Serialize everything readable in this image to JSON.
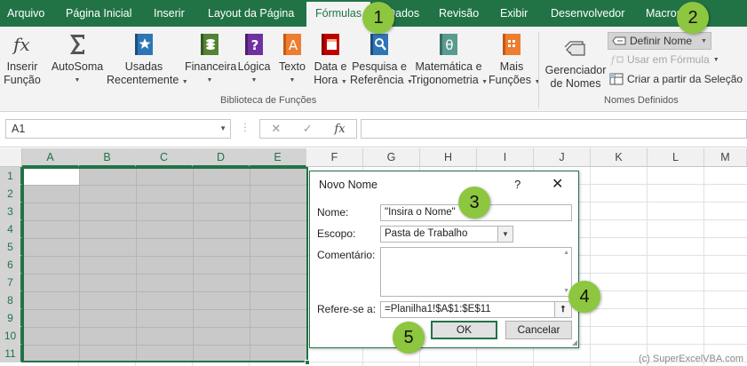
{
  "tabs": [
    "Arquivo",
    "Página Inicial",
    "Inserir",
    "Layout da Página",
    "Fórmulas",
    "Dados",
    "Revisão",
    "Exibir",
    "Desenvolvedor",
    "Macros"
  ],
  "active_tab": "Fórmulas",
  "ribbon": {
    "insert_function": [
      "Inserir",
      "Função"
    ],
    "autosum": "AutoSoma",
    "recent": [
      "Usadas",
      "Recentemente"
    ],
    "financial": "Financeira",
    "logical": "Lógica",
    "text": "Texto",
    "datetime": [
      "Data e",
      "Hora"
    ],
    "lookup": [
      "Pesquisa e",
      "Referência"
    ],
    "math": [
      "Matemática e",
      "Trigonometria"
    ],
    "more": [
      "Mais",
      "Funções"
    ],
    "library_label": "Biblioteca de Funções",
    "name_manager": [
      "Gerenciador",
      "de Nomes"
    ],
    "define_name": "Definir Nome",
    "use_in_formula": "Usar em Fórmula",
    "create_from_selection": "Criar a partir da Seleção",
    "names_label": "Nomes Definidos"
  },
  "formula_bar": {
    "name_box": "A1",
    "cancel_glyph": "✕",
    "enter_glyph": "✓",
    "fx_glyph": "fx"
  },
  "grid": {
    "columns": [
      "A",
      "B",
      "C",
      "D",
      "E",
      "F",
      "G",
      "H",
      "I",
      "J",
      "K",
      "L",
      "M"
    ],
    "rows": [
      "1",
      "2",
      "3",
      "4",
      "5",
      "6",
      "7",
      "8",
      "9",
      "10",
      "11"
    ]
  },
  "dialog": {
    "title": "Novo Nome",
    "help": "?",
    "close": "✕",
    "name_label": "Nome:",
    "name_value": "\"Insira o Nome\"",
    "scope_label": "Escopo:",
    "scope_value": "Pasta de Trabalho",
    "comment_label": "Comentário:",
    "refers_label": "Refere-se a:",
    "refers_value": "=Planilha1!$A$1:$E$11",
    "ok": "OK",
    "cancel": "Cancelar"
  },
  "badges": [
    "1",
    "2",
    "3",
    "4",
    "5"
  ],
  "watermark": "(c) SuperExcelVBA.com",
  "colors": {
    "excel_green": "#217346",
    "badge_green": "#8dc63f",
    "selection_gray": "#c9c9c9"
  },
  "icons": {
    "insert_function": "fx-icon",
    "autosum": "sigma-icon",
    "recent": "star-book-icon",
    "financial": "money-book-icon",
    "logical": "question-book-icon",
    "text": "text-book-icon",
    "datetime": "calendar-book-icon",
    "lookup": "magnifier-book-icon",
    "math": "theta-book-icon",
    "more": "grid-book-icon",
    "name_manager": "tag-stack-icon",
    "define_name": "tag-icon",
    "use_in_formula": "formula-icon",
    "create_from_selection": "table-select-icon"
  }
}
